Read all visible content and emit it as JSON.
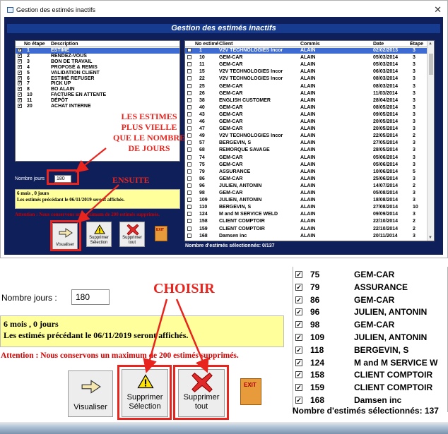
{
  "window": {
    "title": "Gestion des estimés inactifs",
    "header": "Gestion des estimés inactifs"
  },
  "left_grid": {
    "columns": [
      "No étape",
      "Description"
    ],
    "rows": [
      {
        "no": "1",
        "desc": "ESTIMÉ",
        "checked": true,
        "selected": true
      },
      {
        "no": "2",
        "desc": "RENDEZ-VOUS",
        "checked": true
      },
      {
        "no": "3",
        "desc": "BON DE TRAVAIL",
        "checked": true
      },
      {
        "no": "4",
        "desc": "PROPOSÉ & REMIS",
        "checked": true
      },
      {
        "no": "5",
        "desc": "VALIDATION CLIENT",
        "checked": true
      },
      {
        "no": "6",
        "desc": "ESTIMÉ REFUSER",
        "checked": true
      },
      {
        "no": "7",
        "desc": "PICK UP",
        "checked": true
      },
      {
        "no": "8",
        "desc": "BO ALAIN",
        "checked": true
      },
      {
        "no": "10",
        "desc": "FACTURE EN ATTENTE",
        "checked": true
      },
      {
        "no": "11",
        "desc": "DÉPÔT",
        "checked": true
      },
      {
        "no": "20",
        "desc": "ACHAT INTERNE",
        "checked": true
      }
    ]
  },
  "right_grid": {
    "columns": [
      "No estimé",
      "Client",
      "Commis",
      "Date",
      "Étape"
    ],
    "rows": [
      {
        "no": "1",
        "client": "V2V TECHNOLOGIES Incor",
        "commis": "ALAIN",
        "date": "02/02/2013",
        "etape": "3",
        "selected": true
      },
      {
        "no": "10",
        "client": "GEM-CAR",
        "commis": "ALAIN",
        "date": "05/03/2014",
        "etape": "3"
      },
      {
        "no": "11",
        "client": "GEM-CAR",
        "commis": "ALAIN",
        "date": "05/03/2014",
        "etape": "3"
      },
      {
        "no": "15",
        "client": "V2V TECHNOLOGIES Incor",
        "commis": "ALAIN",
        "date": "06/03/2014",
        "etape": "3"
      },
      {
        "no": "22",
        "client": "V2V TECHNOLOGIES Incor",
        "commis": "ALAIN",
        "date": "08/03/2014",
        "etape": "3"
      },
      {
        "no": "25",
        "client": "GEM-CAR",
        "commis": "ALAIN",
        "date": "08/03/2014",
        "etape": "3"
      },
      {
        "no": "26",
        "client": "GEM-CAR",
        "commis": "ALAIN",
        "date": "11/03/2014",
        "etape": "3"
      },
      {
        "no": "38",
        "client": "ENGLISH CUSTOMER",
        "commis": "ALAIN",
        "date": "28/04/2014",
        "etape": "3"
      },
      {
        "no": "40",
        "client": "GEM-CAR",
        "commis": "ALAIN",
        "date": "08/05/2014",
        "etape": "3"
      },
      {
        "no": "43",
        "client": "GEM-CAR",
        "commis": "ALAIN",
        "date": "09/05/2014",
        "etape": "3"
      },
      {
        "no": "46",
        "client": "GEM-CAR",
        "commis": "ALAIN",
        "date": "20/05/2014",
        "etape": "3"
      },
      {
        "no": "47",
        "client": "GEM-CAR",
        "commis": "ALAIN",
        "date": "20/05/2014",
        "etape": "3"
      },
      {
        "no": "49",
        "client": "V2V TECHNOLOGIES Incor",
        "commis": "ALAIN",
        "date": "22/05/2014",
        "etape": "2"
      },
      {
        "no": "57",
        "client": "BERGEVIN, S",
        "commis": "ALAIN",
        "date": "27/05/2014",
        "etape": "3"
      },
      {
        "no": "68",
        "client": "REMORQUE SAVAGE",
        "commis": "ALAIN",
        "date": "28/05/2014",
        "etape": "3"
      },
      {
        "no": "74",
        "client": "GEM-CAR",
        "commis": "ALAIN",
        "date": "05/06/2014",
        "etape": "3"
      },
      {
        "no": "75",
        "client": "GEM-CAR",
        "commis": "ALAIN",
        "date": "05/06/2014",
        "etape": "3"
      },
      {
        "no": "79",
        "client": "ASSURANCE",
        "commis": "ALAIN",
        "date": "10/06/2014",
        "etape": "5"
      },
      {
        "no": "86",
        "client": "GEM-CAR",
        "commis": "ALAIN",
        "date": "25/06/2014",
        "etape": "3"
      },
      {
        "no": "96",
        "client": "JULIEN, ANTONIN",
        "commis": "ALAIN",
        "date": "14/07/2014",
        "etape": "2"
      },
      {
        "no": "98",
        "client": "GEM-CAR",
        "commis": "ALAIN",
        "date": "05/08/2014",
        "etape": "3"
      },
      {
        "no": "109",
        "client": "JULIEN, ANTONIN",
        "commis": "ALAIN",
        "date": "18/08/2014",
        "etape": "3"
      },
      {
        "no": "110",
        "client": "BERGEVIN, S",
        "commis": "ALAIN",
        "date": "27/08/2014",
        "etape": "10"
      },
      {
        "no": "124",
        "client": "M and M SERVICE WELD",
        "commis": "ALAIN",
        "date": "09/09/2014",
        "etape": "3"
      },
      {
        "no": "158",
        "client": "CLIENT COMPTOIR",
        "commis": "ALAIN",
        "date": "22/10/2014",
        "etape": "2"
      },
      {
        "no": "159",
        "client": "CLIENT COMPTOIR",
        "commis": "ALAIN",
        "date": "22/10/2014",
        "etape": "2"
      },
      {
        "no": "168",
        "client": "Damsen inc",
        "commis": "ALAIN",
        "date": "20/11/2014",
        "etape": "3"
      }
    ],
    "footer": "Nombre d'estimés sélectionnés: 0/137"
  },
  "form": {
    "days_label": "Nombre jours",
    "days_label_zoom": "Nombre jours :",
    "days_value": "180",
    "info_line1": "6 mois , 0 jours",
    "info_line2": "Les estimés précédant le 06/11/2019 seront affichés.",
    "warning": "Attention : Nous conservons un maximum de 200 estimés supprimés."
  },
  "toolbar": {
    "visualiser": "Visualiser",
    "supprimer_selection_1": "Supprimer",
    "supprimer_selection_2": "Sélection",
    "supprimer_tout_1": "Supprimer",
    "supprimer_tout_2": "tout",
    "exit": "EXIT"
  },
  "annotations": {
    "les_estimes": [
      "LES ESTIMES",
      "PLUS VIELLE",
      "QUE LE NOMBRE",
      "DE JOURS"
    ],
    "ensuite": "ENSUITE",
    "choisir": "CHOISIR"
  },
  "zoom_list": {
    "rows": [
      {
        "no": "75",
        "client": "GEM-CAR"
      },
      {
        "no": "79",
        "client": "ASSURANCE"
      },
      {
        "no": "86",
        "client": "GEM-CAR"
      },
      {
        "no": "96",
        "client": "JULIEN, ANTONIN"
      },
      {
        "no": "98",
        "client": "GEM-CAR"
      },
      {
        "no": "109",
        "client": "JULIEN, ANTONIN"
      },
      {
        "no": "118",
        "client": "BERGEVIN, S"
      },
      {
        "no": "124",
        "client": "M and M SERVICE W"
      },
      {
        "no": "158",
        "client": "CLIENT COMPTOIR"
      },
      {
        "no": "159",
        "client": "CLIENT COMPTOIR"
      },
      {
        "no": "168",
        "client": "Damsen inc"
      }
    ],
    "footer": "Nombre d'estimés sélectionnés: 137"
  },
  "colors": {
    "window_bg": "#0f1f5a",
    "header_bg": "#173b8f",
    "selection": "#3d6bd2",
    "info_bg": "#ffff9c",
    "warning": "#c80000",
    "annotation": "#e8241e"
  }
}
